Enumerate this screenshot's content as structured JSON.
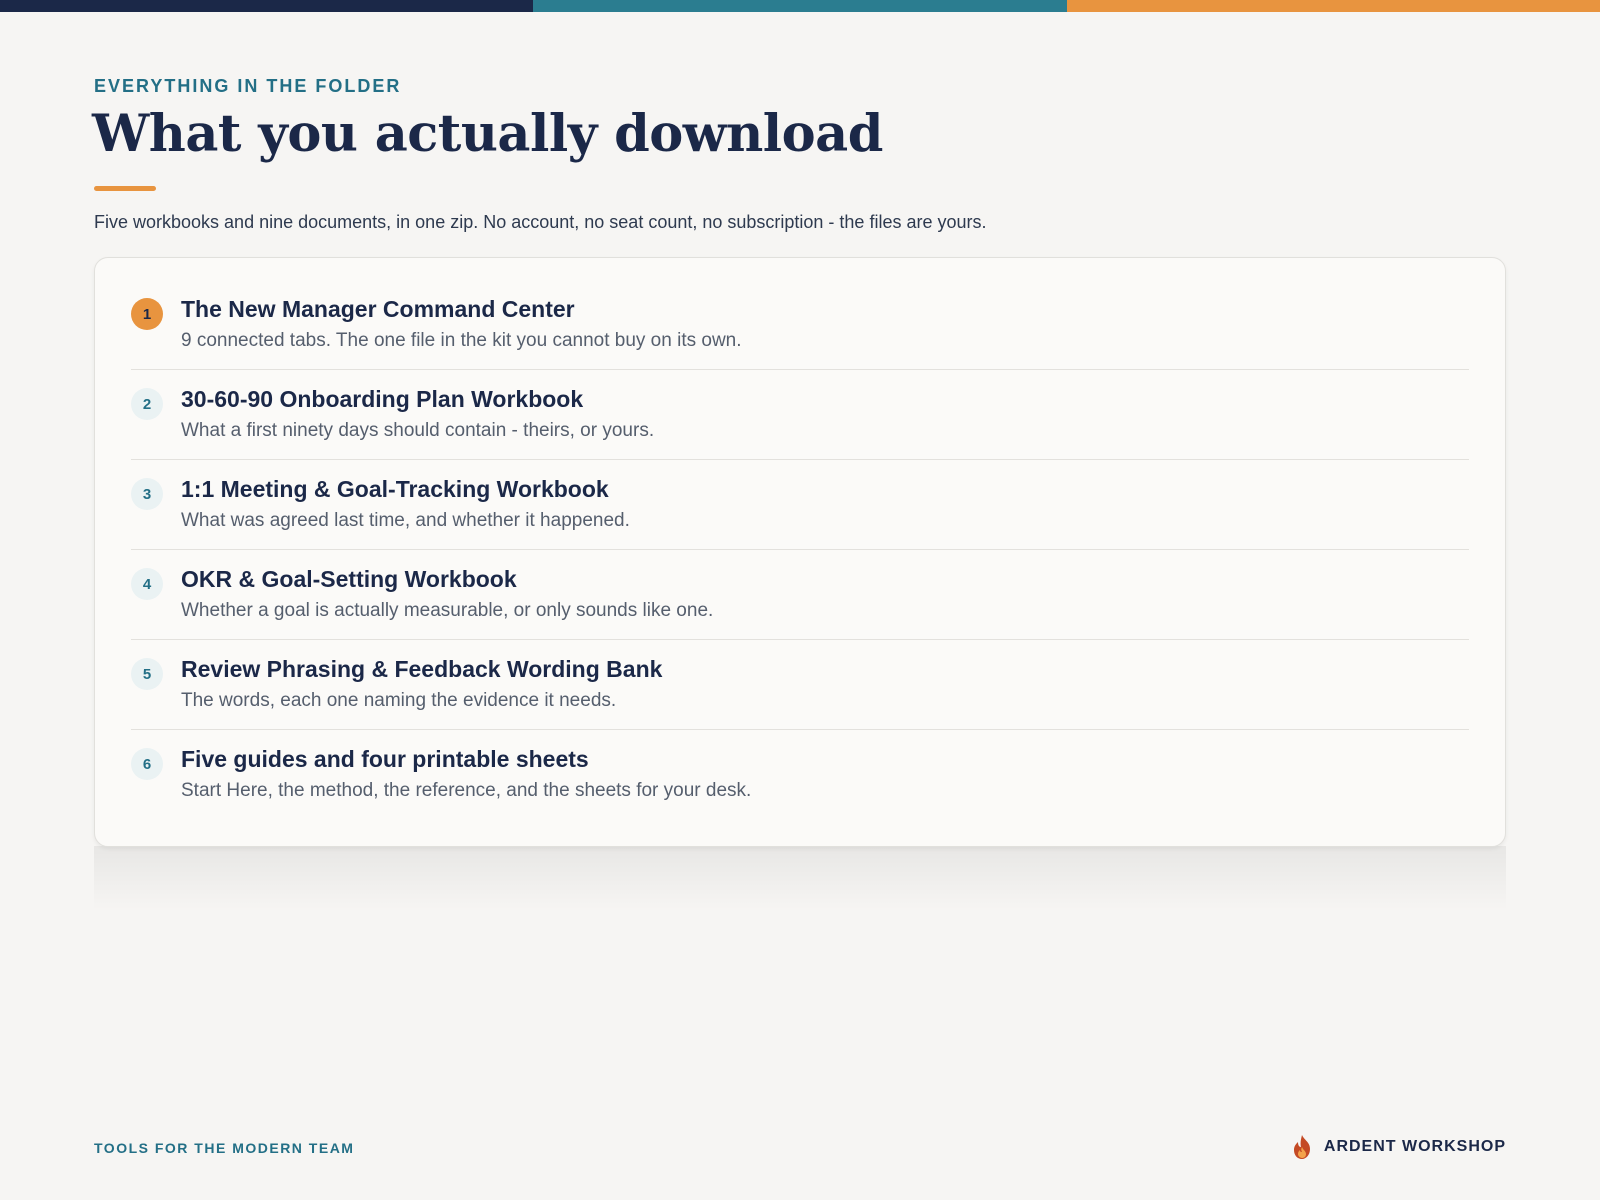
{
  "header": {
    "eyebrow": "EVERYTHING IN THE FOLDER",
    "title": "What you actually download",
    "subtitle": "Five workbooks and nine documents, in one zip. No account, no seat count, no subscription - the files are yours."
  },
  "items": [
    {
      "number": "1",
      "title": "The New Manager Command Center",
      "description": "9 connected tabs. The one file in the kit you cannot buy on its own.",
      "highlighted": true
    },
    {
      "number": "2",
      "title": "30-60-90 Onboarding Plan Workbook",
      "description": "What a first ninety days should contain - theirs, or yours.",
      "highlighted": false
    },
    {
      "number": "3",
      "title": "1:1 Meeting & Goal-Tracking Workbook",
      "description": "What was agreed last time, and whether it happened.",
      "highlighted": false
    },
    {
      "number": "4",
      "title": "OKR & Goal-Setting Workbook",
      "description": "Whether a goal is actually measurable, or only sounds like one.",
      "highlighted": false
    },
    {
      "number": "5",
      "title": "Review Phrasing & Feedback Wording Bank",
      "description": "The words, each one naming the evidence it needs.",
      "highlighted": false
    },
    {
      "number": "6",
      "title": "Five guides and four printable sheets",
      "description": "Start Here, the method, the reference, and the sheets for your desk.",
      "highlighted": false
    }
  ],
  "footer": {
    "tagline": "TOOLS FOR THE MODERN TEAM",
    "brand": "ARDENT WORKSHOP",
    "brand_icon": "flame-icon"
  },
  "colors": {
    "navy": "#1b2848",
    "teal": "#2b7d90",
    "orange": "#e8943f",
    "brand_red": "#c44a24"
  }
}
